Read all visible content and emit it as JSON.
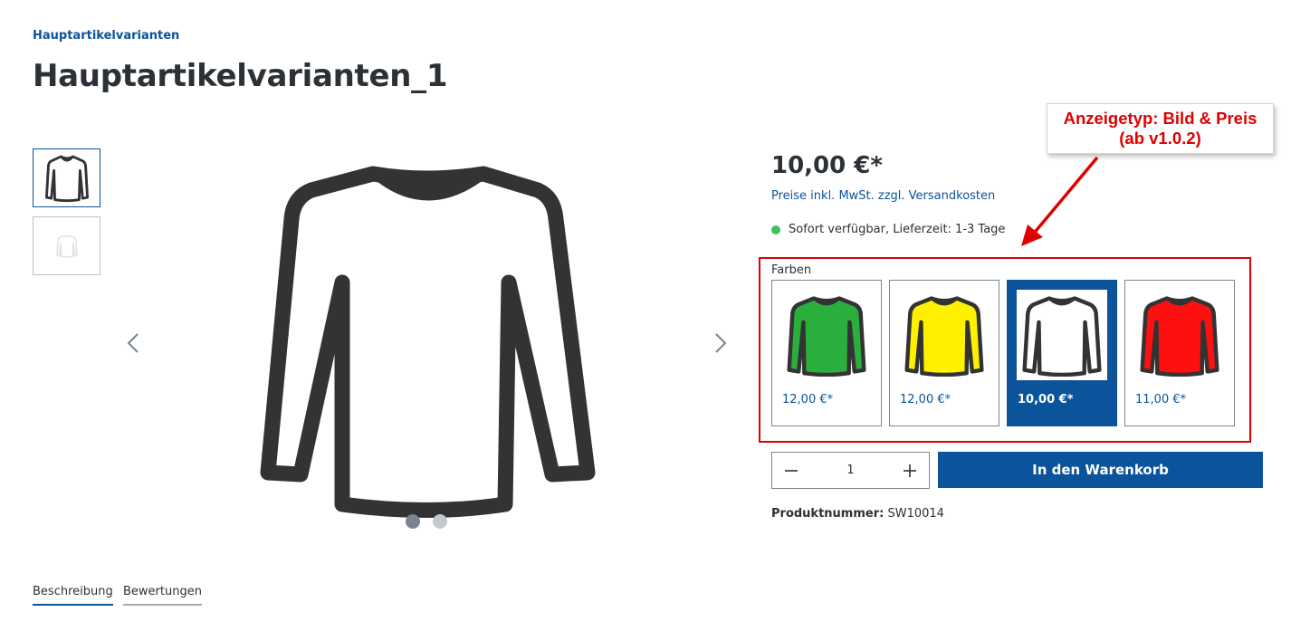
{
  "breadcrumb": {
    "label": "Hauptartikelvarianten"
  },
  "page": {
    "title": "Hauptartikelvarianten_1"
  },
  "gallery": {
    "thumbnails": [
      {
        "name": "shirt-outline-thumb",
        "selected": true
      },
      {
        "name": "shirt-faded-thumb",
        "selected": false
      }
    ],
    "dots": 2,
    "active_dot": 1
  },
  "buybox": {
    "price": "10,00 €*",
    "tax_note": "Preise inkl. MwSt. zzgl. Versandkosten",
    "availability": "Sofort verfügbar, Lieferzeit: 1-3 Tage",
    "availability_color": "#3cc261"
  },
  "annotation": {
    "line1": "Anzeigetyp: Bild & Preis",
    "line2": "(ab v1.0.2)",
    "color": "#e10000"
  },
  "variants": {
    "group_label": "Farben",
    "options": [
      {
        "color": "#2aae3c",
        "price": "12,00 €*",
        "selected": false
      },
      {
        "color": "#fff000",
        "price": "12,00 €*",
        "selected": false
      },
      {
        "color": "#ffffff",
        "price": "10,00 €*",
        "selected": true
      },
      {
        "color": "#ff1010",
        "price": "11,00 €*",
        "selected": false
      }
    ]
  },
  "quantity": {
    "value": "1",
    "minus_icon": "minus-icon",
    "plus_icon": "plus-icon"
  },
  "cart": {
    "button_label": "In den Warenkorb"
  },
  "product_number": {
    "label": "Produktnummer:",
    "value": "SW10014"
  },
  "tabs": [
    {
      "label": "Beschreibung",
      "active": true
    },
    {
      "label": "Bewertungen",
      "active": false
    }
  ],
  "colors": {
    "primary": "#0b539b",
    "text": "#2b3136"
  }
}
